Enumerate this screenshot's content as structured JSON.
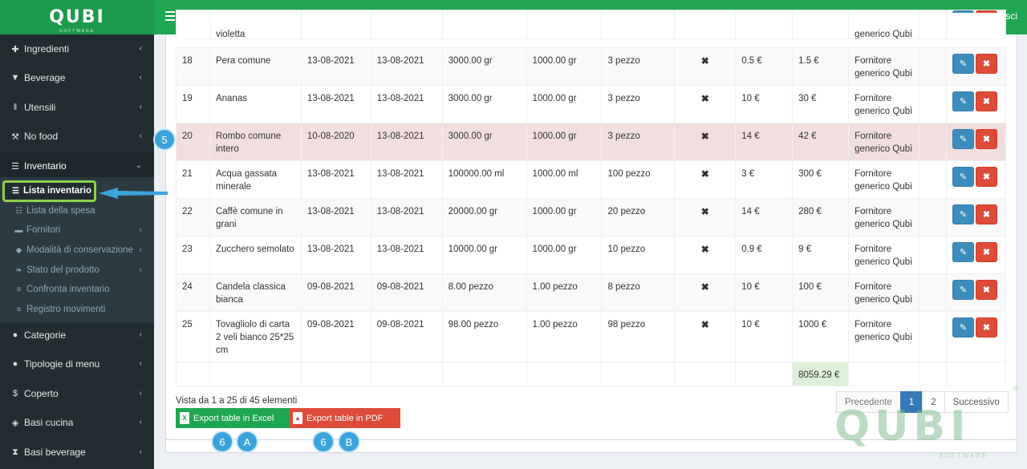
{
  "brand": {
    "logo": "QUBI",
    "logo_sub": "SOFTWARE"
  },
  "topbar": {
    "logout_label": "Esci"
  },
  "sidebar": {
    "items": [
      {
        "label": "Ingredienti",
        "icon": "ingredients-icon"
      },
      {
        "label": "Beverage",
        "icon": "glass-icon"
      },
      {
        "label": "Utensili",
        "icon": "cutlery-icon"
      },
      {
        "label": "No food",
        "icon": "wrench-icon"
      },
      {
        "label": "Inventario",
        "icon": "table-icon"
      },
      {
        "label": "Categorie",
        "icon": "info-icon"
      },
      {
        "label": "Tipologie di menu",
        "icon": "info-icon"
      },
      {
        "label": "Coperto",
        "icon": "dollar-icon"
      },
      {
        "label": "Basi cucina",
        "icon": "cube-icon"
      },
      {
        "label": "Basi beverage",
        "icon": "hourglass-icon"
      }
    ],
    "submenu": [
      {
        "label": "Lista inventario",
        "active": true
      },
      {
        "label": "Lista della spesa"
      },
      {
        "label": "Fornitori"
      },
      {
        "label": "Modalità di conservazione"
      },
      {
        "label": "Stato del prodotto"
      },
      {
        "label": "Confronta inventario"
      },
      {
        "label": "Registro movimenti"
      }
    ]
  },
  "table": {
    "partial_row": {
      "name": "violetta",
      "supplier": "generico Qubì"
    },
    "rows": [
      {
        "id": "18",
        "name": "Pera comune",
        "date1": "13-08-2021",
        "date2": "13-08-2021",
        "qty": "3000.00 gr",
        "unit": "1000.00 gr",
        "pieces": "3 pezzo",
        "price": "0.5 €",
        "total": "1.5 €",
        "supplier": "Fornitore generico Qubì"
      },
      {
        "id": "19",
        "name": "Ananas",
        "date1": "13-08-2021",
        "date2": "13-08-2021",
        "qty": "3000.00 gr",
        "unit": "1000.00 gr",
        "pieces": "3 pezzo",
        "price": "10 €",
        "total": "30 €",
        "supplier": "Fornitore generico Qubì"
      },
      {
        "id": "20",
        "name": "Rombo comune intero",
        "date1": "10-08-2020",
        "date2": "13-08-2021",
        "qty": "3000.00 gr",
        "unit": "1000.00 gr",
        "pieces": "3 pezzo",
        "price": "14 €",
        "total": "42 €",
        "supplier": "Fornitore generico Qubì"
      },
      {
        "id": "21",
        "name": "Acqua gassata minerale",
        "date1": "13-08-2021",
        "date2": "13-08-2021",
        "qty": "100000.00 ml",
        "unit": "1000.00 ml",
        "pieces": "100 pezzo",
        "price": "3 €",
        "total": "300 €",
        "supplier": "Fornitore generico Qubì"
      },
      {
        "id": "22",
        "name": "Caffè comune in grani",
        "date1": "13-08-2021",
        "date2": "13-08-2021",
        "qty": "20000.00 gr",
        "unit": "1000.00 gr",
        "pieces": "20 pezzo",
        "price": "14 €",
        "total": "280 €",
        "supplier": "Fornitore generico Qubì"
      },
      {
        "id": "23",
        "name": "Zucchero semolato",
        "date1": "13-08-2021",
        "date2": "13-08-2021",
        "qty": "10000.00 gr",
        "unit": "1000.00 gr",
        "pieces": "10 pezzo",
        "price": "0.9 €",
        "total": "9 €",
        "supplier": "Fornitore generico Qubì"
      },
      {
        "id": "24",
        "name": "Candela classica bianca",
        "date1": "09-08-2021",
        "date2": "09-08-2021",
        "qty": "8.00 pezzo",
        "unit": "1.00 pezzo",
        "pieces": "8 pezzo",
        "price": "10 €",
        "total": "100 €",
        "supplier": "Fornitore generico Qubì"
      },
      {
        "id": "25",
        "name": "Tovagliolo di carta 2 veli bianco 25*25 cm",
        "date1": "09-08-2021",
        "date2": "09-08-2021",
        "qty": "98.00 pezzo",
        "unit": "1.00 pezzo",
        "pieces": "98 pezzo",
        "price": "10 €",
        "total": "1000 €",
        "supplier": "Fornitore generico Qubì"
      }
    ],
    "grand_total": "8059.29 €"
  },
  "footer": {
    "info": "Vista da 1 a 25 di 45 elementi",
    "export_excel": "Export table in Excel",
    "export_pdf": "Export table in PDF",
    "pagination": {
      "prev": "Precedente",
      "page1": "1",
      "page2": "2",
      "next": "Successivo"
    }
  },
  "annotations": {
    "badge_5": "5",
    "badge_6a_num": "6",
    "badge_6a_letter": "A",
    "badge_6b_num": "6",
    "badge_6b_letter": "B"
  },
  "watermark": {
    "text": "QUBI",
    "sub": "SOFTWARE",
    "reg": "®"
  },
  "colors": {
    "green": "#1fa651",
    "sidebar": "#222d32",
    "blue": "#3c8dbc",
    "red": "#dd4b39",
    "highlight_row": "#f2dede"
  }
}
